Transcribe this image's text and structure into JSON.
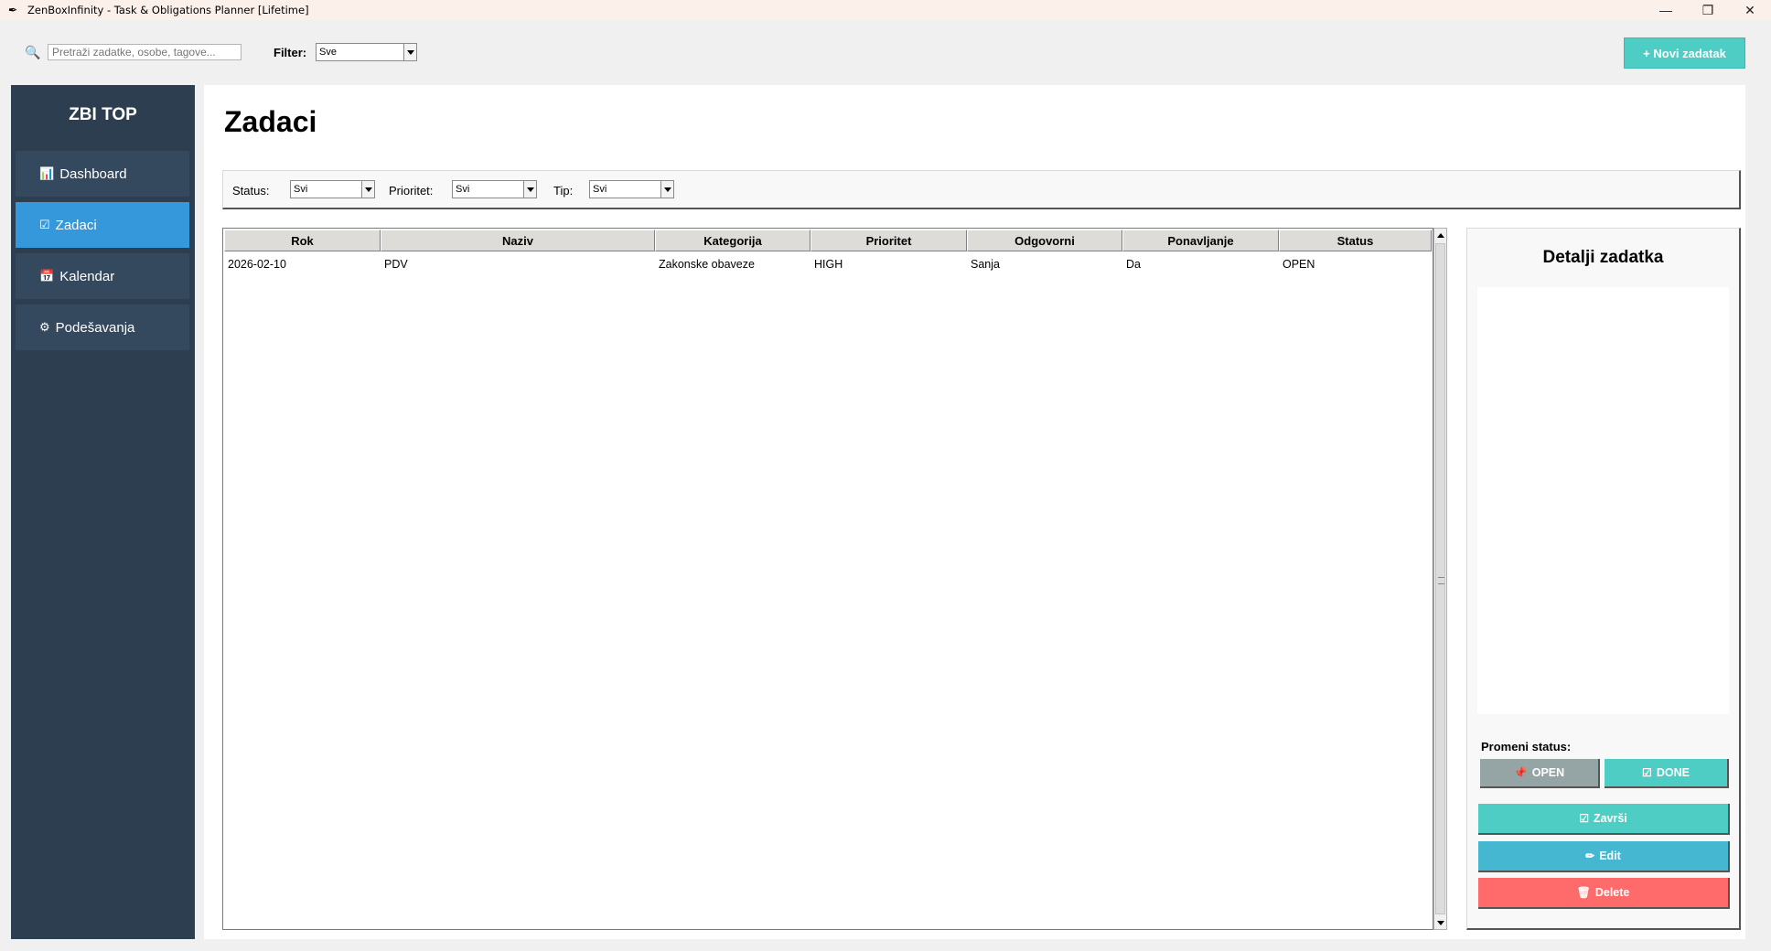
{
  "window": {
    "title": "ZenBoxInfinity - Task & Obligations Planner [Lifetime]",
    "controls": {
      "minimize": "—",
      "maximize": "❐",
      "close": "✕"
    }
  },
  "toolbar": {
    "search_placeholder": "Pretraži zadatke, osobe, tagove...",
    "filter_label": "Filter:",
    "filter_value": "Sve",
    "new_task_label": "+ Novi zadatak"
  },
  "sidebar": {
    "brand": "ZBI TOP",
    "items": [
      {
        "label": "Dashboard",
        "icon": "bar-chart-icon",
        "active": false
      },
      {
        "label": "Zadaci",
        "icon": "checkbox-icon",
        "active": true
      },
      {
        "label": "Kalendar",
        "icon": "calendar-icon",
        "active": false
      },
      {
        "label": "Podešavanja",
        "icon": "gear-icon",
        "active": false
      }
    ]
  },
  "main": {
    "title": "Zadaci",
    "filters": {
      "status_label": "Status:",
      "status_value": "Svi",
      "priority_label": "Prioritet:",
      "priority_value": "Svi",
      "type_label": "Tip:",
      "type_value": "Svi"
    },
    "table": {
      "columns": [
        "Rok",
        "Naziv",
        "Kategorija",
        "Prioritet",
        "Odgovorni",
        "Ponavljanje",
        "Status"
      ],
      "rows": [
        [
          "2026-02-10",
          "PDV",
          "Zakonske obaveze",
          "HIGH",
          "Sanja",
          "Da",
          "OPEN"
        ]
      ]
    }
  },
  "detail": {
    "title": "Detalji zadatka",
    "change_status_label": "Promeni status:",
    "open_label": "OPEN",
    "done_label": "DONE",
    "finish_label": "Završi",
    "edit_label": "Edit",
    "delete_label": "Delete"
  },
  "colors": {
    "sidebar_bg": "#2c3e50",
    "nav_item_bg": "#34495e",
    "nav_active": "#3498db",
    "teal": "#4ecdc4",
    "gray_button": "#95a5a6",
    "blue_button": "#45b7d1",
    "red_button": "#ff6b6b"
  }
}
